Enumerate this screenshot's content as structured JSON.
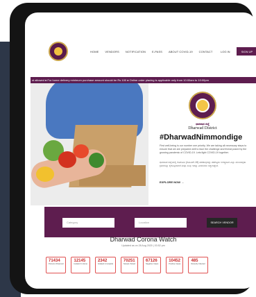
{
  "nav": {
    "items": [
      "HOME",
      "VENDORS",
      "NOTIFICATION",
      "E-PASS",
      "ABOUT COVID-19",
      "CONTACT"
    ],
    "login_label": "LOG IN",
    "signup_label": "SIGN UP"
  },
  "ticker": {
    "text": "st allowed ● For home delivery minimum purchase amount should be Rs 100 ● Online order placing is applicable only from 10:00am to 10:00pm"
  },
  "hero": {
    "kannada_title": "ಧಾರವಾಡ ಜಿಲ್ಲೆ",
    "district": "Dharwad District",
    "hashtag": "#DharwadNimmondige",
    "para1": "First well-being is our number one priority. We are taking all necessary steps to ensure that we are prepared well to face the challenge and threat posed by the growing pandemic of COVID-19. Lets fight COVID-19 together.",
    "para2": "ಧಾರವಾಡ ಜಿಲ್ಲೆಯಲ್ಲಿ ಕೊರೊನಾ (ಕೋವಿಡ್-19) ಹರಡುವುದನ್ನು ತಡೆಗಟ್ಟಲು ಅಗತ್ಯವಾದ ಎಲ್ಲಾ ಮುಂಜಾಗ್ರತಾ ಕ್ರಮಗಳನ್ನು ಕೈಗೊಳ್ಳಲಾಗಿದೆ ಮತ್ತು ನಾವು ಇದನ್ನು ಎದುರಿಸಲು ಸಜ್ಜಾಗಿದ್ದೇವೆ.",
    "explore_label": "EXPLORE NOW →"
  },
  "search": {
    "category_placeholder": "Category",
    "location_placeholder": "Location",
    "button_label": "SEARCH VENDOR"
  },
  "watch": {
    "title": "Dharwad Corona Watch",
    "updated": "Updated as on 28 Aug 2020 | 03:52 pm",
    "stats": [
      {
        "value": "71434",
        "label": "Persons Observed"
      },
      {
        "value": "12145",
        "label": "Isolated in Home"
      },
      {
        "value": "2342",
        "label": "Isolated in Hospital"
      },
      {
        "value": "70251",
        "label": "Sample Tested"
      },
      {
        "value": "67126",
        "label": "Negative Cases"
      },
      {
        "value": "10452",
        "label": "Positive Cases"
      },
      {
        "value": "485",
        "label": "Recently Infected"
      }
    ]
  },
  "colors": {
    "brand": "#5e1d4f",
    "stat": "#c62828"
  }
}
